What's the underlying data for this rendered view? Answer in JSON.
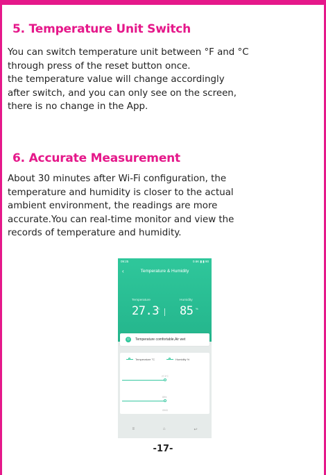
{
  "section5": {
    "title": "5. Temperature Unit Switch",
    "lines": [
      "You can switch temperature unit between °F and °C",
      "through press of the reset button once.",
      "the temperature value will change accordingly",
      "after switch, and you can only see on the screen,",
      "there is no change in the App."
    ]
  },
  "section6": {
    "title": "6. Accurate Measurement",
    "lines": [
      "About 30 minutes after Wi-Fi configuration, the",
      "temperature and humidity is closer to the actual",
      "ambient environment, the readings are more",
      "accurate.You can real-time monitor and view the",
      "records of temperature and humidity."
    ]
  },
  "phone": {
    "status_time": "09:25",
    "status_right": "0.6K ▮ ▮ 90",
    "nav_title": "Temperature & Humidity",
    "back_icon": "chevron-left",
    "temp_label": "Temperature",
    "temp_value": "27.3",
    "temp_unit": "°C",
    "hum_label": "Humidity",
    "hum_value": "85",
    "hum_unit": "%",
    "status_text": "Temperature comfortable,Air wet",
    "legend_temp": "Temperature °C",
    "legend_hum": "Humidity %",
    "graph_temp_value": "27.3°C",
    "graph_hum_value": "85%",
    "graph_time": "09:00",
    "softkeys": [
      "≡",
      "⌂",
      "↩"
    ],
    "accent_color": "#2fc79b"
  },
  "page_number": "-17-",
  "border_color": "#e5188a"
}
